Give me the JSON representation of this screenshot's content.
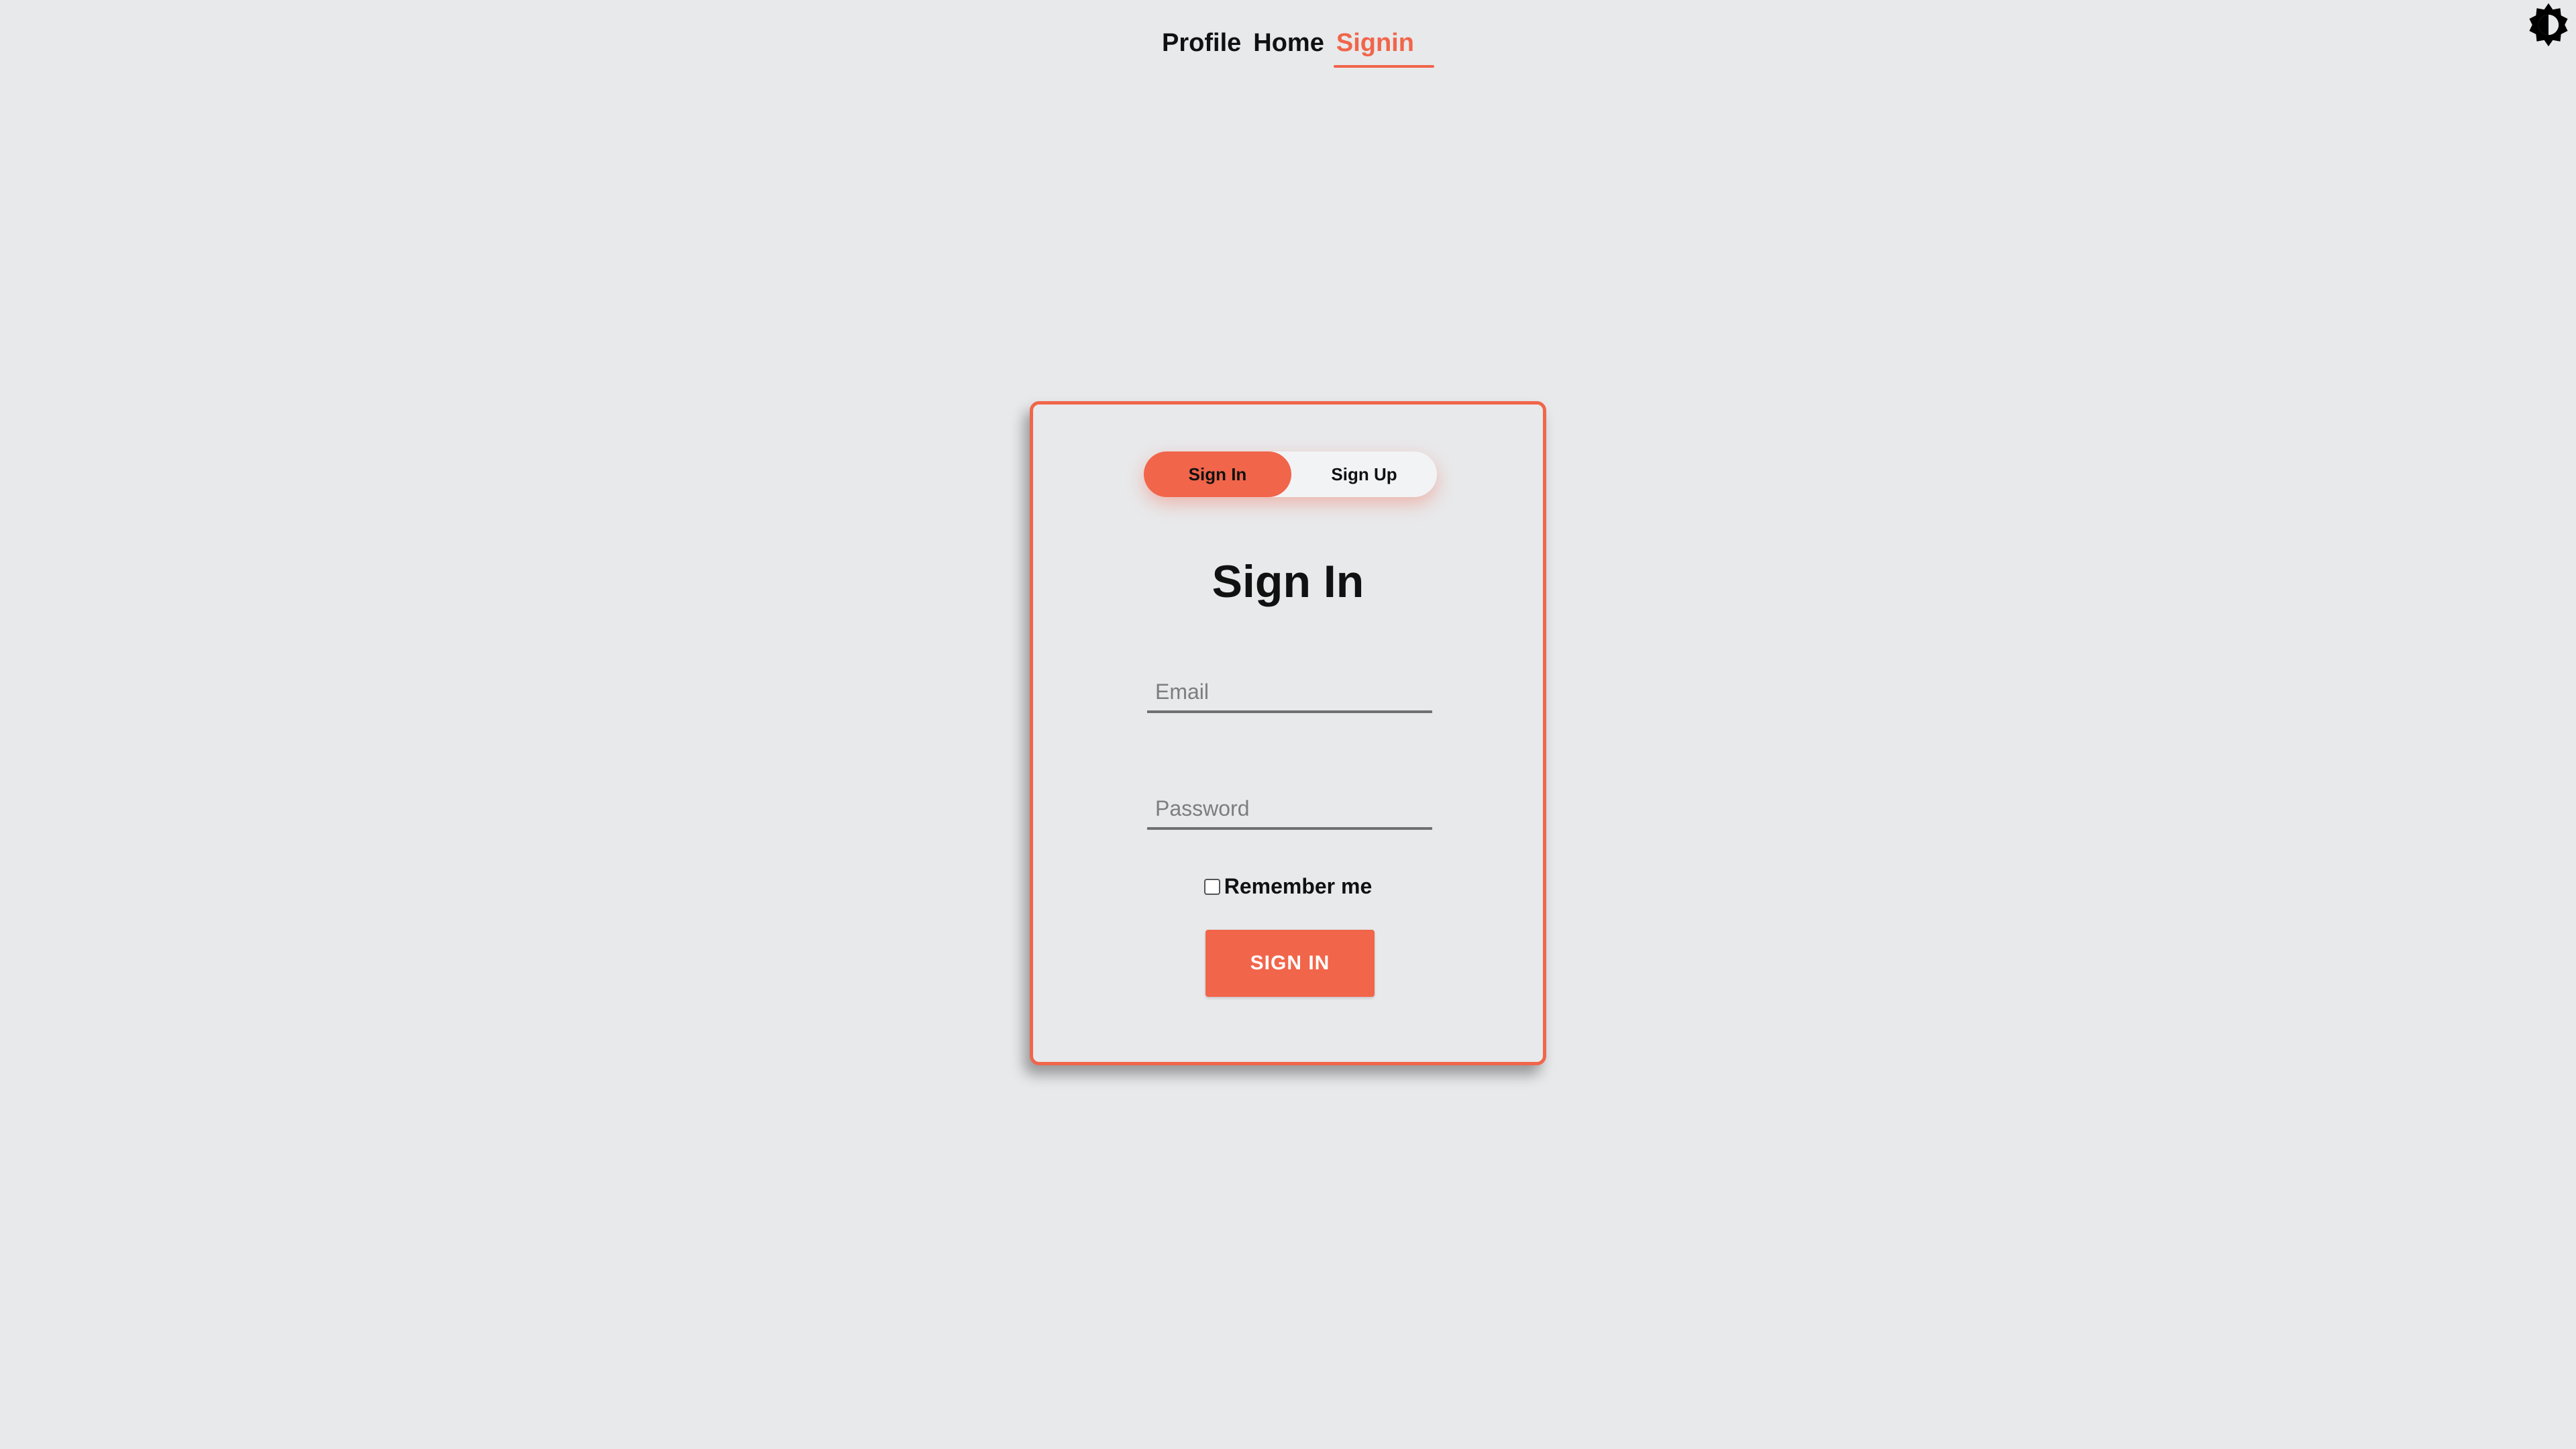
{
  "nav": {
    "items": [
      {
        "label": "Profile"
      },
      {
        "label": "Home"
      },
      {
        "label": "Signin",
        "active": true
      }
    ]
  },
  "theme_toggle": {
    "icon": "brightness-contrast-icon"
  },
  "auth_card": {
    "mode_switch": {
      "signin_label": "Sign In",
      "signup_label": "Sign Up",
      "selected": "Sign In"
    },
    "title": "Sign In",
    "email": {
      "placeholder": "Email",
      "value": ""
    },
    "password": {
      "placeholder": "Password",
      "value": ""
    },
    "remember": {
      "label": "Remember me",
      "checked": false
    },
    "submit_label": "SIGN IN"
  },
  "colors": {
    "accent": "#f1654a",
    "background": "#e8e9eb"
  }
}
